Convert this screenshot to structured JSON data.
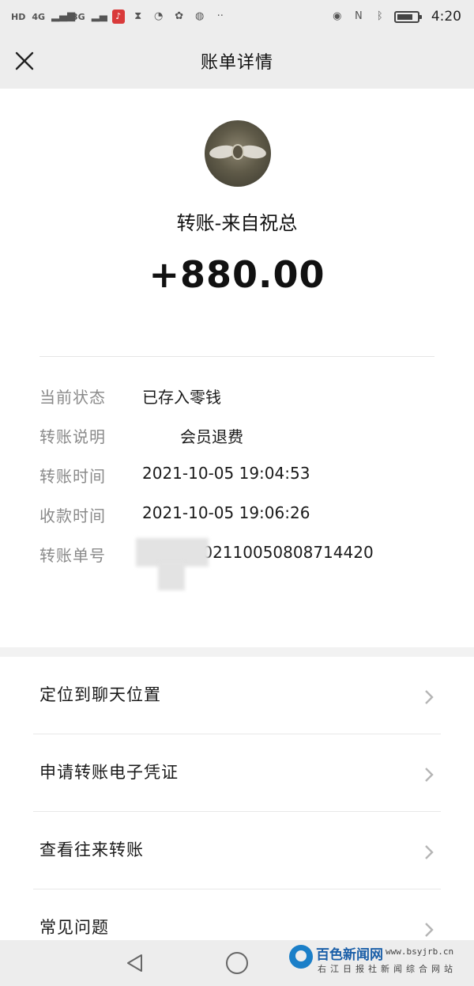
{
  "status_bar": {
    "left_chips": [
      "HD",
      "4G",
      "3G"
    ],
    "time": "4:20",
    "icons": [
      "hd-icon",
      "signal-4g-icon",
      "signal-3g-icon",
      "mic-icon",
      "hourglass-icon",
      "app-icon",
      "baidu-icon",
      "vpn-icon",
      "more-icon",
      "eye-icon",
      "nfc-icon",
      "bluetooth-icon",
      "battery-icon"
    ]
  },
  "header": {
    "title": "账单详情"
  },
  "transfer": {
    "payer": "转账-来自祝总",
    "amount": "+880.00"
  },
  "details": [
    {
      "label": "当前状态",
      "value": "已存入零钱"
    },
    {
      "label": "转账说明",
      "value": "会员退费"
    },
    {
      "label": "转账时间",
      "value": "2021-10-05 19:04:53"
    },
    {
      "label": "收款时间",
      "value": "2021-10-05 19:06:26"
    },
    {
      "label": "转账单号",
      "value": "1000120211005080871442​0"
    }
  ],
  "menu": [
    {
      "label": "定位到聊天位置"
    },
    {
      "label": "申请转账电子凭证"
    },
    {
      "label": "查看往来转账"
    },
    {
      "label": "常见问题"
    }
  ],
  "watermark": {
    "name": "百色新闻网",
    "url": "www.bsyjrb.cn",
    "sub": "右江日报社新闻综合网站"
  },
  "colors": {
    "background": "#ededed",
    "card": "#ffffff",
    "label_gray": "#8a8a8a",
    "brand_blue": "#1b7fc8"
  }
}
